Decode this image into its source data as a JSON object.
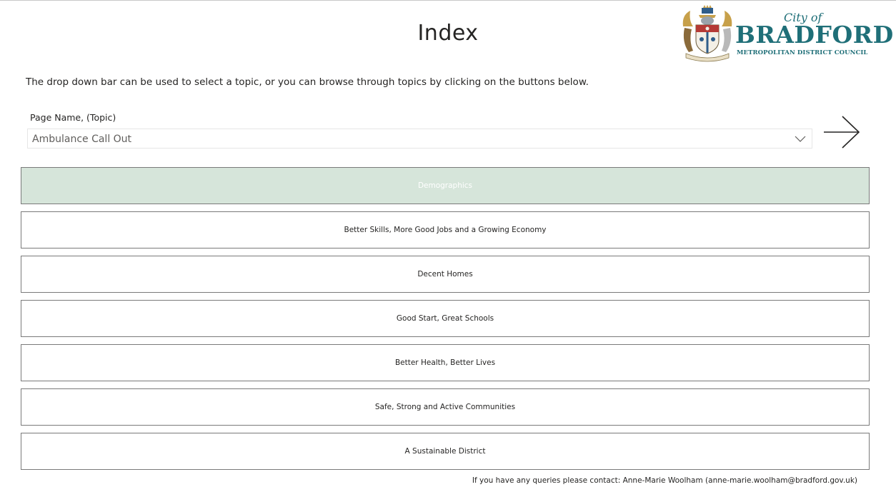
{
  "header": {
    "title": "Index"
  },
  "logo": {
    "city_of": "City of",
    "name": "BRADFORD",
    "subtitle": "METROPOLITAN DISTRICT COUNCIL",
    "icon": "coat-of-arms-icon",
    "brand_color": "#1f6f78"
  },
  "intro": {
    "text": "The drop down bar can be used to select a topic, or you can browse through topics by clicking on the buttons below."
  },
  "slicer": {
    "label": "Page Name, (Topic)",
    "selected_value": "Ambulance Call Out",
    "icon": "chevron-down-icon"
  },
  "next_button": {
    "icon": "arrow-right-icon"
  },
  "topics": [
    {
      "label": "Demographics",
      "active": true
    },
    {
      "label": "Better Skills, More Good Jobs and a Growing Economy",
      "active": false
    },
    {
      "label": "Decent Homes",
      "active": false
    },
    {
      "label": "Good Start, Great Schools",
      "active": false
    },
    {
      "label": "Better Health, Better Lives",
      "active": false
    },
    {
      "label": "Safe, Strong and Active Communities",
      "active": false
    },
    {
      "label": "A Sustainable District",
      "active": false
    }
  ],
  "colors": {
    "active_button": "#d6e5da",
    "button_border": "#7a7a7a"
  },
  "footer": {
    "text": "If you have any queries please contact: Anne-Marie Woolham (anne-marie.woolham@bradford.gov.uk)"
  }
}
